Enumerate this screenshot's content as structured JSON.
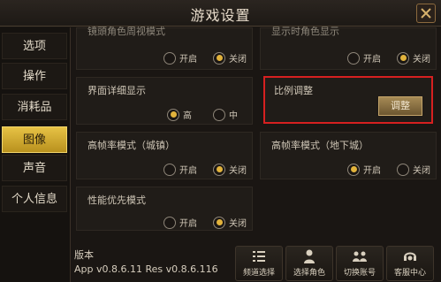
{
  "header": {
    "title": "游戏设置"
  },
  "sidebar": {
    "items": [
      {
        "label": "选项",
        "active": false
      },
      {
        "label": "操作",
        "active": false
      },
      {
        "label": "消耗品",
        "active": false
      },
      {
        "label": "图像",
        "active": true
      },
      {
        "label": "声音",
        "active": false
      },
      {
        "label": "个人信息",
        "active": false
      }
    ]
  },
  "settings": {
    "row0_left": {
      "label": "镜頭角色周视模式",
      "opt_on": "开启",
      "opt_off": "关闭",
      "selected": "关闭"
    },
    "row0_right": {
      "label": "显示时角色显示",
      "opt_on": "开启",
      "opt_off": "关闭",
      "selected": "关闭"
    },
    "detail": {
      "label": "界面详细显示",
      "opt_high": "高",
      "opt_mid": "中",
      "selected": "高"
    },
    "ratio": {
      "label": "比例调整",
      "button": "调整"
    },
    "fps_town": {
      "label": "高帧率模式（城镇）",
      "opt_on": "开启",
      "opt_off": "关闭",
      "selected": "关闭"
    },
    "fps_dungeon": {
      "label": "高帧率模式（地下城）",
      "opt_on": "开启",
      "opt_off": "关闭",
      "selected": "开启"
    },
    "perf": {
      "label": "性能优先模式",
      "opt_on": "开启",
      "opt_off": "关闭",
      "selected": "关闭"
    }
  },
  "footer": {
    "version_label": "版本",
    "version_value": "App v0.8.6.11 Res v0.8.6.116",
    "buttons": [
      {
        "label": "频道选择",
        "icon": "list-icon"
      },
      {
        "label": "选择角色",
        "icon": "character-icon"
      },
      {
        "label": "切换账号",
        "icon": "switch-account-icon"
      },
      {
        "label": "客服中心",
        "icon": "support-icon"
      }
    ]
  },
  "colors": {
    "accent_gold": "#e2b33c",
    "highlight_red": "#d62020"
  }
}
